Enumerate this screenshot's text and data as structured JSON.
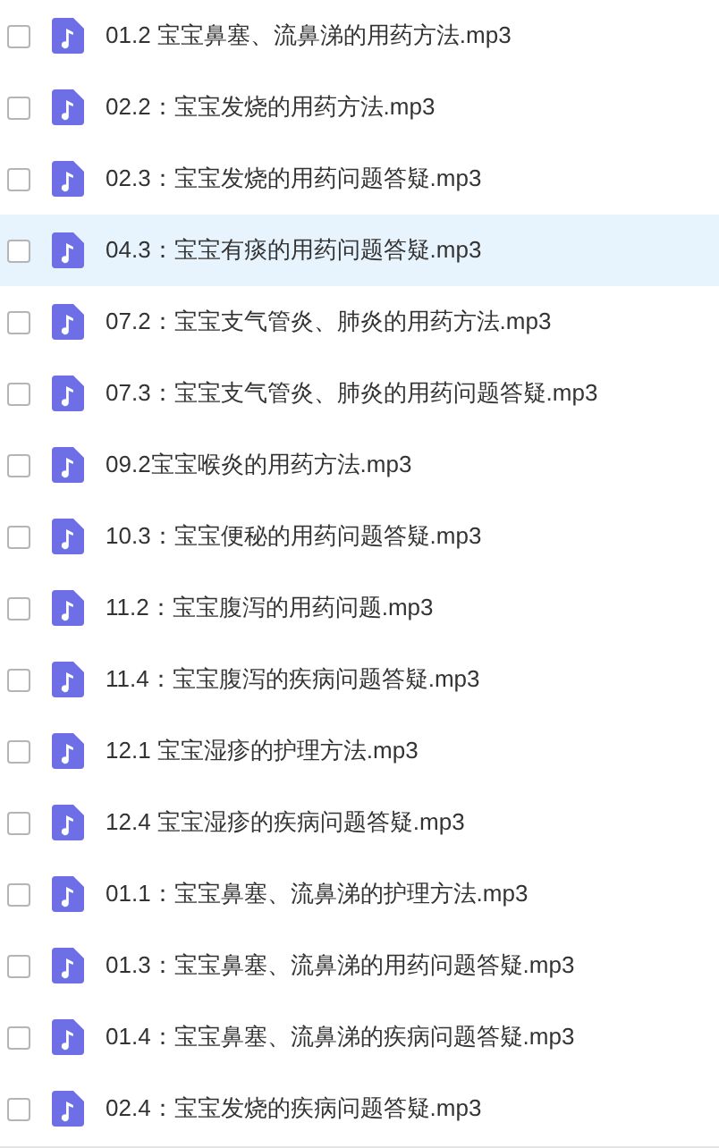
{
  "files": [
    {
      "name": "01.2 宝宝鼻塞、流鼻涕的用药方法.mp3",
      "checked": false,
      "selected": false
    },
    {
      "name": "02.2：宝宝发烧的用药方法.mp3",
      "checked": false,
      "selected": false
    },
    {
      "name": "02.3：宝宝发烧的用药问题答疑.mp3",
      "checked": false,
      "selected": false
    },
    {
      "name": "04.3：宝宝有痰的用药问题答疑.mp3",
      "checked": false,
      "selected": true
    },
    {
      "name": "07.2：宝宝支气管炎、肺炎的用药方法.mp3",
      "checked": false,
      "selected": false
    },
    {
      "name": "07.3：宝宝支气管炎、肺炎的用药问题答疑.mp3",
      "checked": false,
      "selected": false
    },
    {
      "name": "09.2宝宝喉炎的用药方法.mp3",
      "checked": false,
      "selected": false
    },
    {
      "name": "10.3：宝宝便秘的用药问题答疑.mp3",
      "checked": false,
      "selected": false
    },
    {
      "name": "11.2：宝宝腹泻的用药问题.mp3",
      "checked": false,
      "selected": false
    },
    {
      "name": "11.4：宝宝腹泻的疾病问题答疑.mp3",
      "checked": false,
      "selected": false
    },
    {
      "name": "12.1 宝宝湿疹的护理方法.mp3",
      "checked": false,
      "selected": false
    },
    {
      "name": "12.4 宝宝湿疹的疾病问题答疑.mp3",
      "checked": false,
      "selected": false
    },
    {
      "name": "01.1：宝宝鼻塞、流鼻涕的护理方法.mp3",
      "checked": false,
      "selected": false
    },
    {
      "name": "01.3：宝宝鼻塞、流鼻涕的用药问题答疑.mp3",
      "checked": false,
      "selected": false
    },
    {
      "name": "01.4：宝宝鼻塞、流鼻涕的疾病问题答疑.mp3",
      "checked": false,
      "selected": false
    },
    {
      "name": "02.4：宝宝发烧的疾病问题答疑.mp3",
      "checked": false,
      "selected": false
    }
  ]
}
